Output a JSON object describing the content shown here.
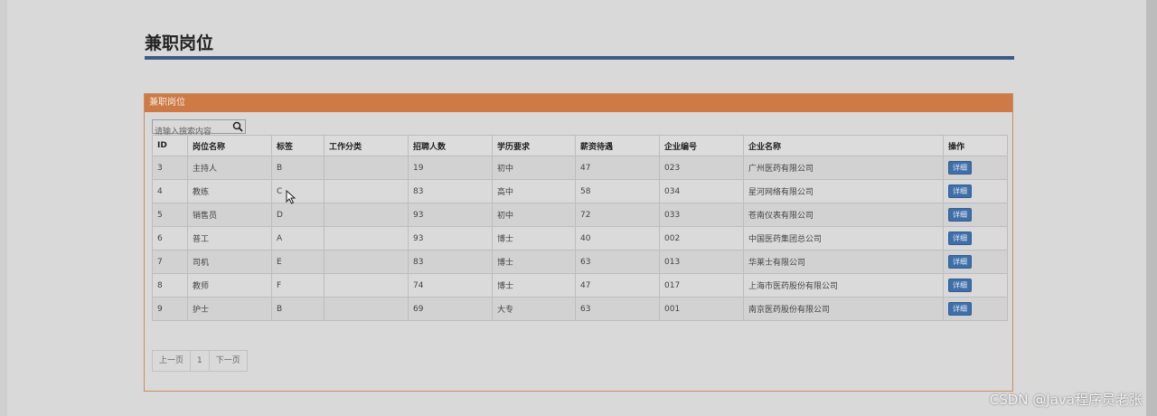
{
  "page": {
    "title": "兼职岗位"
  },
  "panel": {
    "title": "兼职岗位"
  },
  "search": {
    "placeholder": "请输入搜索内容",
    "icon": "search-icon"
  },
  "table": {
    "headers": [
      "ID",
      "岗位名称",
      "标签",
      "工作分类",
      "招聘人数",
      "学历要求",
      "薪资待遇",
      "企业编号",
      "企业名称",
      "操作"
    ],
    "rows": [
      {
        "id": "3",
        "name": "主持人",
        "tag": "B",
        "category": "",
        "count": "19",
        "education": "初中",
        "salary": "47",
        "company_no": "023",
        "company_name": "广州医药有限公司",
        "action": "详细"
      },
      {
        "id": "4",
        "name": "教练",
        "tag": "C",
        "category": "",
        "count": "83",
        "education": "高中",
        "salary": "58",
        "company_no": "034",
        "company_name": "星河网络有限公司",
        "action": "详细"
      },
      {
        "id": "5",
        "name": "销售员",
        "tag": "D",
        "category": "",
        "count": "93",
        "education": "初中",
        "salary": "72",
        "company_no": "033",
        "company_name": "苍南仪表有限公司",
        "action": "详细"
      },
      {
        "id": "6",
        "name": "普工",
        "tag": "A",
        "category": "",
        "count": "93",
        "education": "博士",
        "salary": "40",
        "company_no": "002",
        "company_name": "中国医药集团总公司",
        "action": "详细"
      },
      {
        "id": "7",
        "name": "司机",
        "tag": "E",
        "category": "",
        "count": "83",
        "education": "博士",
        "salary": "63",
        "company_no": "013",
        "company_name": "华莱士有限公司",
        "action": "详细"
      },
      {
        "id": "8",
        "name": "教师",
        "tag": "F",
        "category": "",
        "count": "74",
        "education": "博士",
        "salary": "47",
        "company_no": "017",
        "company_name": "上海市医药股份有限公司",
        "action": "详细"
      },
      {
        "id": "9",
        "name": "护士",
        "tag": "B",
        "category": "",
        "count": "69",
        "education": "大专",
        "salary": "63",
        "company_no": "001",
        "company_name": "南京医药股份有限公司",
        "action": "详细"
      }
    ]
  },
  "pagination": {
    "prev": "上一页",
    "current": "1",
    "next": "下一页"
  },
  "watermark": "CSDN @Java程序员老张",
  "colors": {
    "title_rule": "#3e5a88",
    "panel_header": "#cd7a46",
    "detail_button": "#3f6fa8"
  }
}
